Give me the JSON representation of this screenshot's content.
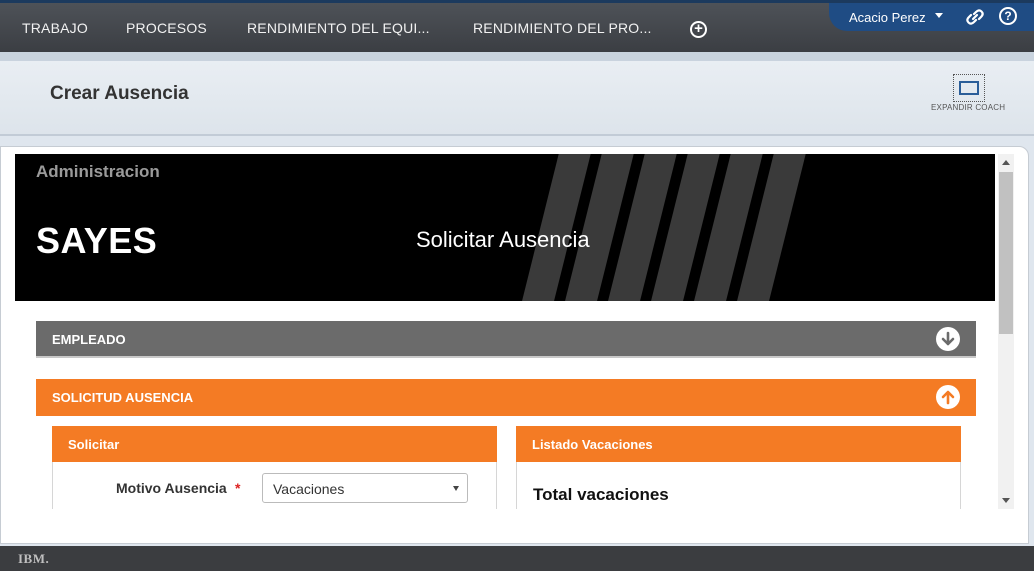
{
  "nav": {
    "tabs": [
      {
        "label": "TRABAJO"
      },
      {
        "label": "PROCESOS"
      },
      {
        "label": "RENDIMIENTO DEL EQUI..."
      },
      {
        "label": "RENDIMIENTO DEL PRO..."
      }
    ],
    "add_icon": "plus-circle-icon"
  },
  "user": {
    "name": "Acacio Perez",
    "link_icon": "link-icon",
    "help_icon": "help-icon"
  },
  "header": {
    "title": "Crear Ausencia",
    "expand_label": "EXPANDIR COACH"
  },
  "banner": {
    "admin": "Administracion",
    "brand": "SAYES",
    "subtitle": "Solicitar Ausencia"
  },
  "sections": {
    "empleado": "EMPLEADO",
    "solicitud": "SOLICITUD AUSENCIA"
  },
  "solicitar": {
    "title": "Solicitar",
    "motivo_label": "Motivo Ausencia",
    "required_mark": "*",
    "motivo_value": "Vacaciones"
  },
  "listado": {
    "title": "Listado Vacaciones",
    "total_label": "Total vacaciones"
  },
  "footer": {
    "logo": "IBM."
  },
  "colors": {
    "accent_orange": "#f47b24",
    "nav_dark": "#3b3e43",
    "user_blue": "#1f4c84",
    "section_gray": "#6b6b6b"
  }
}
